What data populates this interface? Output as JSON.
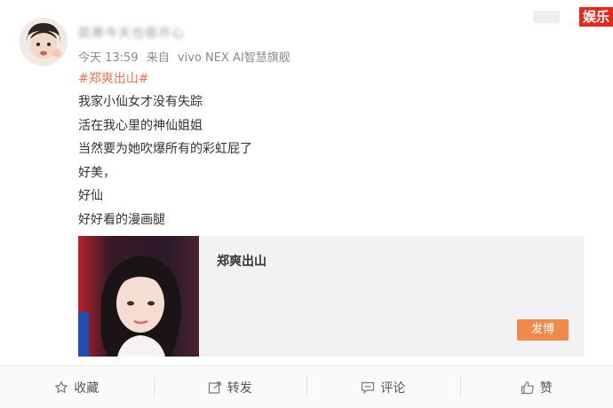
{
  "post": {
    "username": "凯蒂今天也很开心",
    "time": "今天 13:59",
    "source_prefix": "来自",
    "source": "vivo NEX AI智慧旗舰",
    "topic": "#郑爽出山#",
    "lines": [
      "我家小仙女才没有失踪",
      "活在我心里的神仙姐姐",
      "当然要为她吹爆所有的彩虹屁了",
      "好美，",
      "好仙",
      "好好看的漫画腿"
    ]
  },
  "card": {
    "title": "郑爽出山",
    "button_label": "发博"
  },
  "watermark": {
    "label": "娱乐"
  },
  "actions": {
    "favorite": "收藏",
    "repost": "转发",
    "comment": "评论",
    "like": "赞"
  },
  "colors": {
    "topic": "#eb7350",
    "button": "#f08a4b",
    "watermark": "#e32a22"
  }
}
